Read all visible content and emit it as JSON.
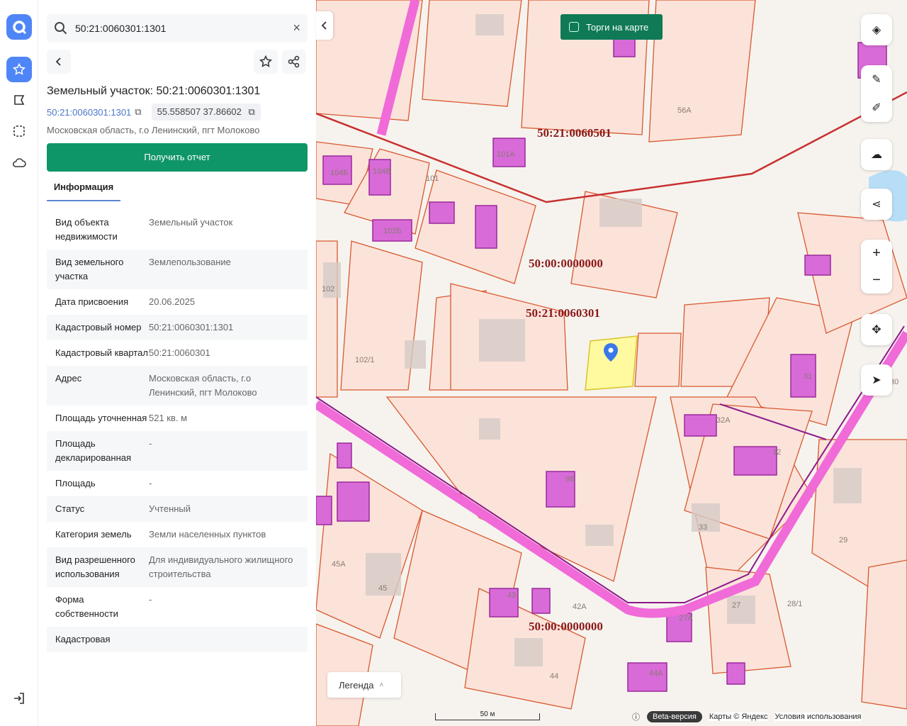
{
  "search": {
    "value": "50:21:0060301:1301"
  },
  "object": {
    "title": "Земельный участок: 50:21:0060301:1301",
    "cad_link": "50:21:0060301:1301",
    "coords": "55.558507 37.86602",
    "address": "Московская область, г.о Ленинский, пгт Молоково",
    "report_button": "Получить отчет",
    "tab": "Информация"
  },
  "info_rows": [
    {
      "k": "Вид объекта недвижимости",
      "v": "Земельный участок"
    },
    {
      "k": "Вид земельного участка",
      "v": "Землепользование"
    },
    {
      "k": "Дата присвоения",
      "v": "20.06.2025"
    },
    {
      "k": "Кадастровый номер",
      "v": "50:21:0060301:1301"
    },
    {
      "k": "Кадастровый квартал",
      "v": "50:21:0060301"
    },
    {
      "k": "Адрес",
      "v": "Московская область, г.о Ленинский, пгт Молоково"
    },
    {
      "k": "Площадь уточненная",
      "v": "521 кв. м"
    },
    {
      "k": "Площадь декларированная",
      "v": "-"
    },
    {
      "k": "Площадь",
      "v": "-"
    },
    {
      "k": "Статус",
      "v": "Учтенный"
    },
    {
      "k": "Категория земель",
      "v": "Земли населенных пунктов"
    },
    {
      "k": "Вид разрешенного использования",
      "v": "Для индивидуального жилищного строительства"
    },
    {
      "k": "Форма собственности",
      "v": "-"
    },
    {
      "k": "Кадастровая",
      "v": ""
    }
  ],
  "map": {
    "torgi": "Торги на карте",
    "legend": "Легенда",
    "scale": "50 м",
    "beta": "Beta-версия",
    "copyright": "Карты © Яндекс",
    "terms": "Условия использования",
    "cad_labels": [
      "50:21:0060501",
      "50:00:0000000",
      "50:21:0060301",
      "50:00:0000000"
    ],
    "house_numbers": [
      "101А",
      "104Б",
      "104В",
      "101",
      "102Б",
      "102",
      "102/1",
      "56А",
      "98",
      "32А",
      "32",
      "31",
      "33",
      "29",
      "45А",
      "45",
      "43",
      "42А",
      "44",
      "44А",
      "27",
      "28/1",
      "27А",
      "30"
    ]
  }
}
